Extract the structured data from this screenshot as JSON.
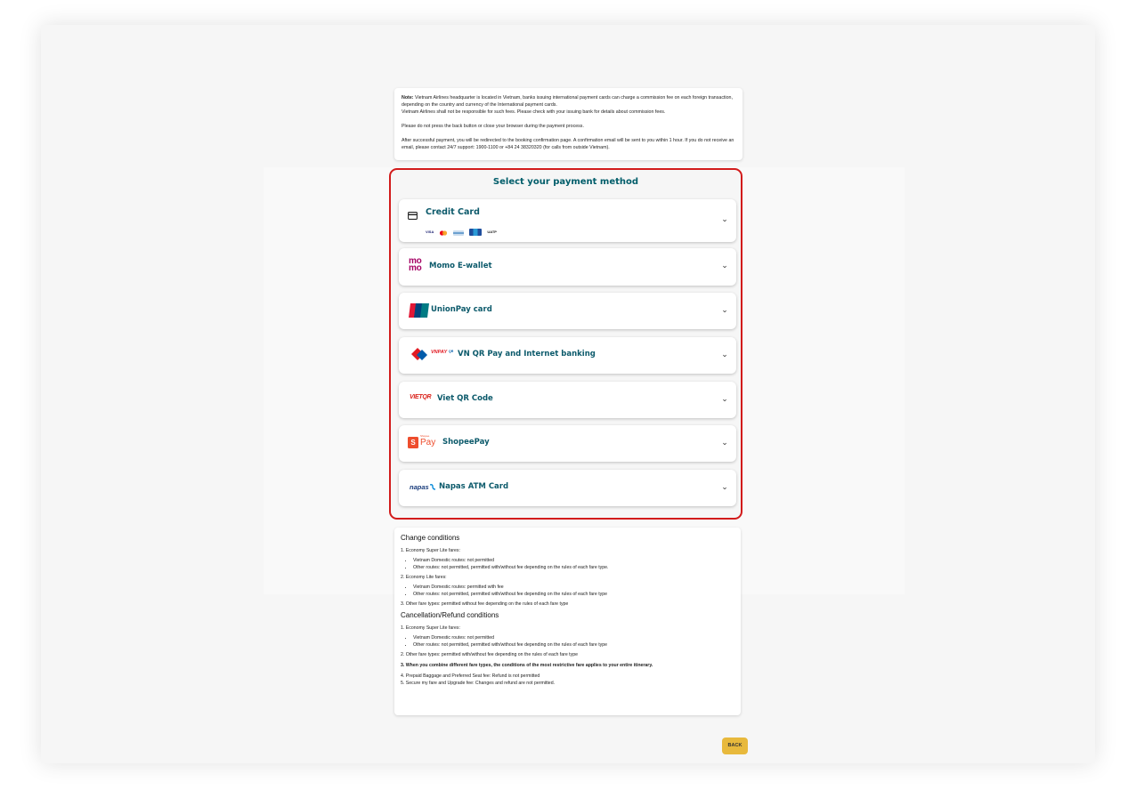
{
  "note": {
    "prefix": "Note:",
    "line1": " Vietnam Airlines headquarter is located in Vietnam, banks issuing international payment cards can charge a commission fee on each foreign transaction, depending on the country and currency of the International payment cards.",
    "line2": "Vietnam Airlines shall not be responsible for such fees. Please check with your issuing bank for details about commission fees.",
    "line3": "Please do not press the back button or close your browser during the payment process.",
    "line4": "After successful payment, you will be redirected to the booking confirmation page. A confirmation email will be sent to you within 1 hour. If you do not receive an email, please contact 24/7 support: 1900-1100 or +84 24 38320320 (for calls from outside Vietnam)."
  },
  "payment": {
    "title": "Select your payment method",
    "methods": [
      {
        "label": "Credit Card",
        "icon": "credit-card-icon"
      },
      {
        "label": "Momo E-wallet",
        "icon": "momo-logo"
      },
      {
        "label": "UnionPay card",
        "icon": "unionpay-logo"
      },
      {
        "label": "VN QR Pay and Internet banking",
        "icon": "vnpay-logo"
      },
      {
        "label": "Viet QR Code",
        "icon": "vietqr-logo"
      },
      {
        "label": "ShopeePay",
        "icon": "shopeepay-logo"
      },
      {
        "label": "Napas ATM Card",
        "icon": "napas-logo"
      }
    ],
    "card_brands": [
      "VISA",
      "MC",
      "AMEX",
      "JCB",
      "UATP"
    ],
    "logo_text": {
      "momo_top": "mo",
      "momo_bottom": "mo",
      "unionpay": "UnionPay",
      "vnpay": "VNPAY",
      "vnpay_sub": "QR",
      "vietqr": "VIETQR",
      "shopee_s": "S",
      "shopee_pay": "Pay",
      "shopee_small": "Shopee",
      "napas": "napas"
    },
    "chevron": "⌄"
  },
  "conditions": {
    "change_title": "Change conditions",
    "c1": "1. Economy Super Lite fares:",
    "c1a": "Vietnam Domestic routes: not permitted",
    "c1b": "Other routes: not permitted, permitted with/without fee depending on the rules of each fare type.",
    "c2": "2. Economy Lite fares:",
    "c2a": "Vietnam Domestic routes: permitted with fee",
    "c2b": "Other routes: not permitted, permitted with/without fee depending on the rules of each fare type",
    "c3": "3. Other fare types: permitted without fee depending on the rules of each fare type",
    "cancel_title": "Cancellation/Refund conditions",
    "r1": "1. Economy Super Lite fares:",
    "r1a": "Vietnam Domestic routes: not permitted",
    "r1b": "Other routes: not permitted, permitted with/without fee depending on the rules of each fare type",
    "r2": "2. Other fare types: permitted with/without fee depending on the rules of each fare type",
    "r3": "3. When you combine different fare types, the conditions of the most restrictive fare applies to your entire itinerary.",
    "r4": "4. Prepaid Baggage and Preferred Seat fee: Refund is not permitted",
    "r5": "5. Secure my fare and Upgrade fee: Changes and refund are not permitted."
  },
  "back_label": "BACK",
  "colors": {
    "accent": "#005d6a",
    "highlight_border": "#d21b1b",
    "back_button": "#e8b93c"
  }
}
